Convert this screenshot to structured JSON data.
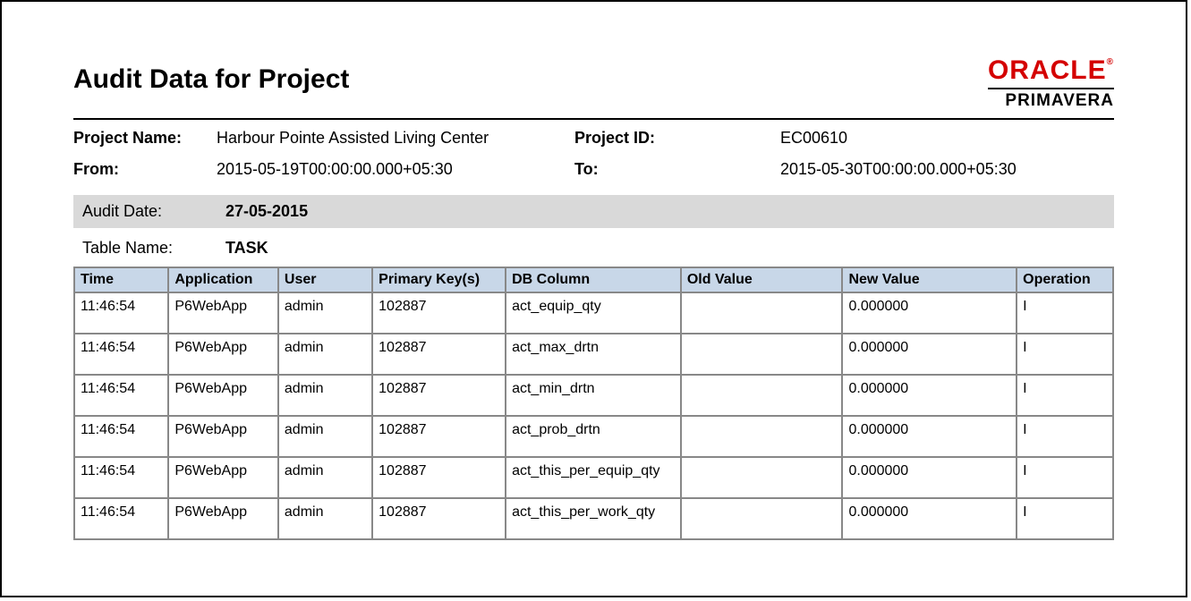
{
  "report": {
    "title": "Audit Data for Project"
  },
  "logo": {
    "brand": "ORACLE",
    "subbrand": "PRIMAVERA"
  },
  "meta": {
    "project_name_label": "Project Name:",
    "project_name_value": "Harbour Pointe Assisted Living Center",
    "project_id_label": "Project ID:",
    "project_id_value": "EC00610",
    "from_label": "From:",
    "from_value": "2015-05-19T00:00:00.000+05:30",
    "to_label": "To:",
    "to_value": "2015-05-30T00:00:00.000+05:30"
  },
  "audit_date": {
    "label": "Audit Date:",
    "value": "27-05-2015"
  },
  "table_name": {
    "label": "Table Name:",
    "value": "TASK"
  },
  "columns": {
    "time": "Time",
    "application": "Application",
    "user": "User",
    "primary_keys": "Primary Key(s)",
    "db_column": "DB Column",
    "old_value": "Old Value",
    "new_value": "New Value",
    "operation": "Operation"
  },
  "rows": [
    {
      "time": "11:46:54",
      "application": "P6WebApp",
      "user": "admin",
      "primary_key": "102887",
      "db_column": "act_equip_qty",
      "old_value": "",
      "new_value": "0.000000",
      "operation": "I"
    },
    {
      "time": "11:46:54",
      "application": "P6WebApp",
      "user": "admin",
      "primary_key": "102887",
      "db_column": "act_max_drtn",
      "old_value": "",
      "new_value": "0.000000",
      "operation": "I"
    },
    {
      "time": "11:46:54",
      "application": "P6WebApp",
      "user": "admin",
      "primary_key": "102887",
      "db_column": "act_min_drtn",
      "old_value": "",
      "new_value": "0.000000",
      "operation": "I"
    },
    {
      "time": "11:46:54",
      "application": "P6WebApp",
      "user": "admin",
      "primary_key": "102887",
      "db_column": "act_prob_drtn",
      "old_value": "",
      "new_value": "0.000000",
      "operation": "I"
    },
    {
      "time": "11:46:54",
      "application": "P6WebApp",
      "user": "admin",
      "primary_key": "102887",
      "db_column": "act_this_per_equip_qty",
      "old_value": "",
      "new_value": "0.000000",
      "operation": "I"
    },
    {
      "time": "11:46:54",
      "application": "P6WebApp",
      "user": "admin",
      "primary_key": "102887",
      "db_column": "act_this_per_work_qty",
      "old_value": "",
      "new_value": "0.000000",
      "operation": "I"
    }
  ]
}
